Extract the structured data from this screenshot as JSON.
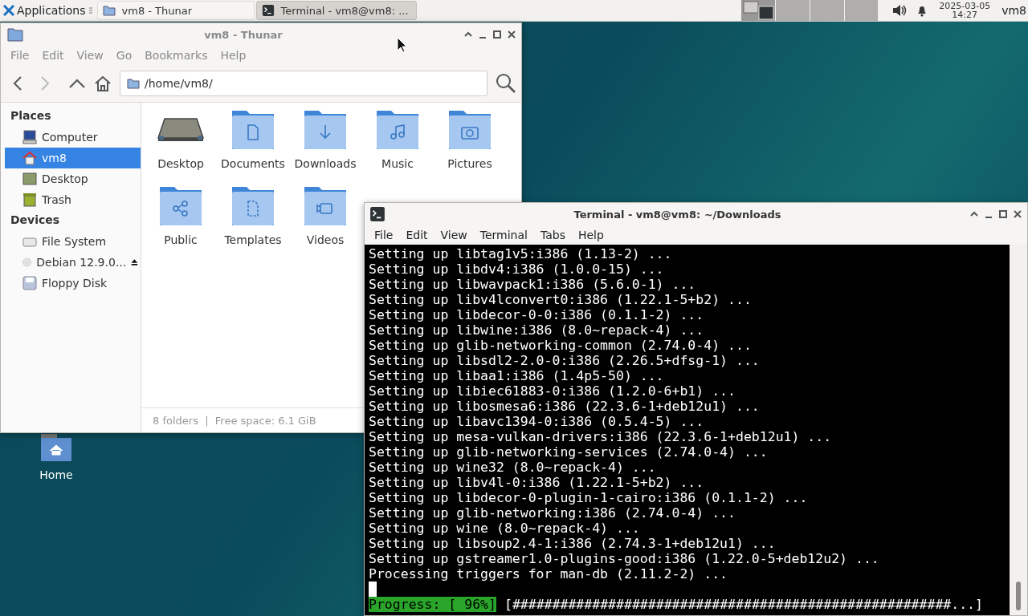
{
  "taskbar": {
    "applications": "Applications",
    "tasks": [
      {
        "label": "vm8 - Thunar",
        "selected": false
      },
      {
        "label": "Terminal - vm8@vm8: ...",
        "selected": true
      }
    ],
    "date": "2025-03-05",
    "time": "14:27",
    "user": "vm8"
  },
  "desktop_icons": [
    {
      "label": "Home"
    }
  ],
  "thunar": {
    "title": "vm8 - Thunar",
    "active": false,
    "menu": [
      "File",
      "Edit",
      "View",
      "Go",
      "Bookmarks",
      "Help"
    ],
    "path": "/home/vm8/",
    "sections": [
      {
        "title": "Places",
        "items": [
          {
            "label": "Computer",
            "selected": false
          },
          {
            "label": "vm8",
            "selected": true
          },
          {
            "label": "Desktop",
            "selected": false
          },
          {
            "label": "Trash",
            "selected": false
          }
        ]
      },
      {
        "title": "Devices",
        "items": [
          {
            "label": "File System",
            "selected": false
          },
          {
            "label": "Debian 12.9.0...",
            "selected": false,
            "eject": true
          },
          {
            "label": "Floppy Disk",
            "selected": false
          }
        ]
      }
    ],
    "folders": [
      "Desktop",
      "Documents",
      "Downloads",
      "Music",
      "Pictures",
      "Public",
      "Templates",
      "Videos"
    ],
    "status": "8 folders  |  Free space: 6.1 GiB"
  },
  "terminal": {
    "title": "Terminal - vm8@vm8: ~/Downloads",
    "active": true,
    "menu": [
      "File",
      "Edit",
      "View",
      "Terminal",
      "Tabs",
      "Help"
    ],
    "lines": [
      "Setting up libtag1v5:i386 (1.13-2) ...",
      "Setting up libdv4:i386 (1.0.0-15) ...",
      "Setting up libwavpack1:i386 (5.6.0-1) ...",
      "Setting up libv4lconvert0:i386 (1.22.1-5+b2) ...",
      "Setting up libdecor-0-0:i386 (0.1.1-2) ...",
      "Setting up libwine:i386 (8.0~repack-4) ...",
      "Setting up glib-networking-common (2.74.0-4) ...",
      "Setting up libsdl2-2.0-0:i386 (2.26.5+dfsg-1) ...",
      "Setting up libaa1:i386 (1.4p5-50) ...",
      "Setting up libiec61883-0:i386 (1.2.0-6+b1) ...",
      "Setting up libosmesa6:i386 (22.3.6-1+deb12u1) ...",
      "Setting up libavc1394-0:i386 (0.5.4-5) ...",
      "Setting up mesa-vulkan-drivers:i386 (22.3.6-1+deb12u1) ...",
      "Setting up glib-networking-services (2.74.0-4) ...",
      "Setting up wine32 (8.0~repack-4) ...",
      "Setting up libv4l-0:i386 (1.22.1-5+b2) ...",
      "Setting up libdecor-0-plugin-1-cairo:i386 (0.1.1-2) ...",
      "Setting up glib-networking:i386 (2.74.0-4) ...",
      "Setting up wine (8.0~repack-4) ...",
      "Setting up libsoup2.4-1:i386 (2.74.3-1+deb12u1) ...",
      "Setting up gstreamer1.0-plugins-good:i386 (1.22.0-5+deb12u2) ...",
      "Processing triggers for man-db (2.11.2-2) ..."
    ],
    "progress_label": "Progress: [ 96%]",
    "progress_bar": "[#######################################################...]"
  }
}
